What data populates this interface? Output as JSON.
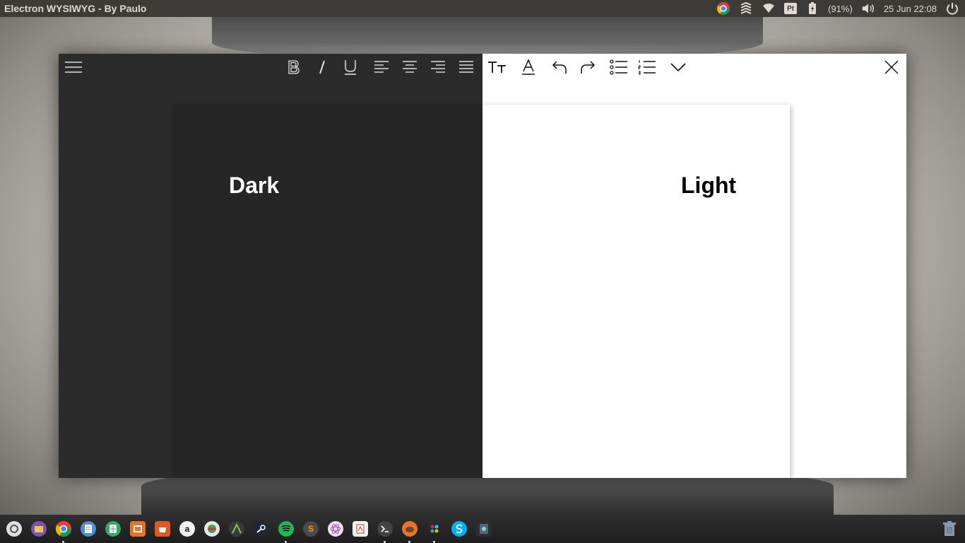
{
  "topbar": {
    "window_title": "Electron WYSIWYG - By Paulo",
    "keyboard_layout": "Pt",
    "battery": "(91%)",
    "datetime": "25 Jun 22:08"
  },
  "editor": {
    "dark_label": "Dark",
    "light_label": "Light",
    "toolbar": [
      "menu-icon",
      "bold-icon",
      "italic-icon",
      "underline-icon",
      "align-left-icon",
      "align-center-icon",
      "align-right-icon",
      "align-justify-icon",
      "font-size-icon",
      "font-color-icon",
      "undo-icon",
      "redo-icon",
      "bullet-list-icon",
      "numbered-list-icon",
      "chevron-down-icon",
      "close-icon"
    ]
  },
  "dock": {
    "apps": [
      "ubuntu-icon",
      "files-icon",
      "chrome-icon",
      "docs-icon",
      "sheets-icon",
      "slides-icon",
      "software-center-icon",
      "amazon-icon",
      "synaptic-icon",
      "android-studio-icon",
      "steam-icon",
      "spotify-icon",
      "sublime-icon",
      "atom-icon",
      "document-viewer-icon",
      "terminal-icon",
      "gimp-icon",
      "slack-icon",
      "skype-icon",
      "app-icon",
      "trash-icon"
    ],
    "sublime_letter": "S",
    "amazon_letter": "a"
  },
  "colors": {
    "dark_bg": "#2b2b2b",
    "dark_page": "#262626",
    "light_bg": "#ffffff",
    "topbar": "#3c3b37"
  }
}
